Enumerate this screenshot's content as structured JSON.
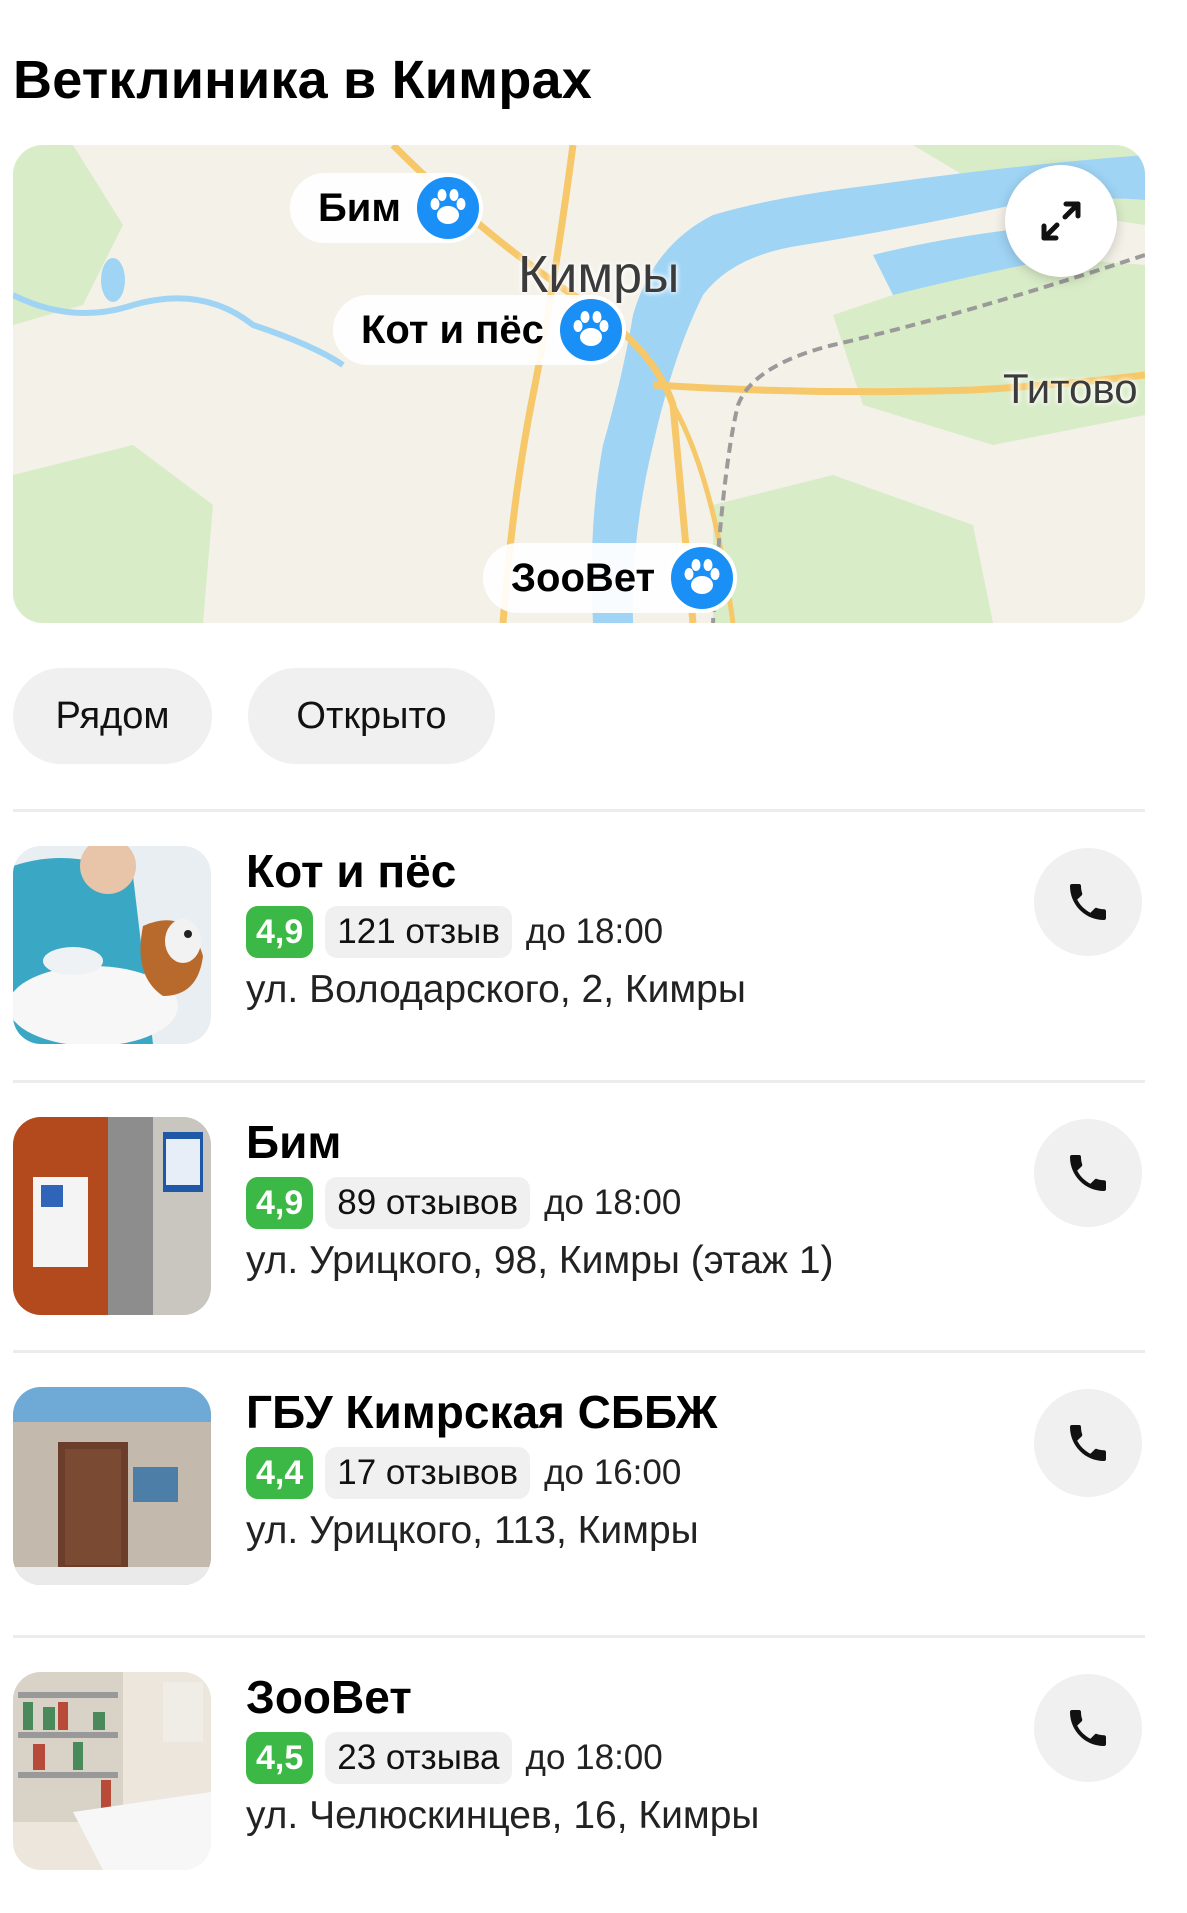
{
  "page": {
    "title": "Ветклиника в Кимрах"
  },
  "map": {
    "labels": {
      "city": "Кимры",
      "town": "Титово"
    },
    "pins": [
      {
        "label": "Бим",
        "icon": "paw-icon"
      },
      {
        "label": "Кот и пёс",
        "icon": "paw-icon"
      },
      {
        "label": "ЗооВет",
        "icon": "paw-icon"
      }
    ],
    "expand_icon": "expand-arrows-icon",
    "colors": {
      "water": "#9fd4f5",
      "road": "#f6c86a",
      "land": "#f4f1e8",
      "park": "#d9ecc8",
      "pin": "#1a8ff5"
    }
  },
  "filters": [
    {
      "label": "Рядом"
    },
    {
      "label": "Открыто"
    }
  ],
  "results": [
    {
      "name": "Кот и пёс",
      "rating": "4,9",
      "reviews": "121 отзыв",
      "hours": "до 18:00",
      "address": "ул. Володарского, 2, Кимры",
      "call_icon": "phone-icon"
    },
    {
      "name": "Бим",
      "rating": "4,9",
      "reviews": "89 отзывов",
      "hours": "до 18:00",
      "address": "ул. Урицкого, 98, Кимры (этаж 1)",
      "call_icon": "phone-icon"
    },
    {
      "name": "ГБУ Кимрская СББЖ",
      "rating": "4,4",
      "reviews": "17 отзывов",
      "hours": "до 16:00",
      "address": "ул. Урицкого, 113, Кимры",
      "call_icon": "phone-icon"
    },
    {
      "name": "ЗооВет",
      "rating": "4,5",
      "reviews": "23 отзыва",
      "hours": "до 18:00",
      "address": "ул. Челюскинцев, 16, Кимры",
      "call_icon": "phone-icon"
    }
  ],
  "theme": {
    "rating_green": "#3cb846",
    "chip_bg": "#f0f0f0"
  }
}
